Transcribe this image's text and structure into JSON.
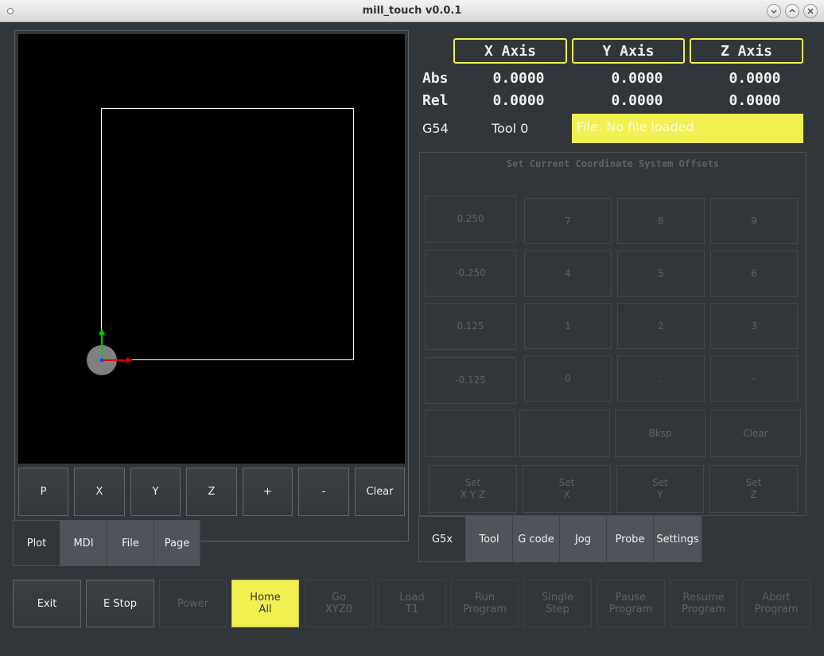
{
  "window": {
    "title": "mill_touch v0.0.1"
  },
  "plot_buttons": [
    "P",
    "X",
    "Y",
    "Z",
    "+",
    "-",
    "Clear"
  ],
  "left_tabs": [
    {
      "label": "Plot",
      "active": true
    },
    {
      "label": "MDI",
      "active": false
    },
    {
      "label": "File",
      "active": false
    },
    {
      "label": "Page",
      "active": false
    }
  ],
  "dro": {
    "axes": [
      "X Axis",
      "Y Axis",
      "Z Axis"
    ],
    "abs_label": "Abs",
    "rel_label": "Rel",
    "abs": [
      "0.0000",
      "0.0000",
      "0.0000"
    ],
    "rel": [
      "0.0000",
      "0.0000",
      "0.0000"
    ],
    "work_offset": "G54",
    "tool": "Tool 0",
    "file": "File: No file loaded"
  },
  "offsets": {
    "title": "Set Current Coordinate System Offsets",
    "increments": [
      "0.250",
      "-0.250",
      "0.125",
      "-0.125"
    ],
    "keys": [
      "7",
      "8",
      "9",
      "4",
      "5",
      "6",
      "1",
      "2",
      "3",
      "0",
      ".",
      "-"
    ],
    "bksp": "Bksp",
    "clear": "Clear",
    "set_buttons": [
      "Set\nX Y Z",
      "Set\nX",
      "Set\nY",
      "Set\nZ"
    ]
  },
  "right_tabs": [
    {
      "label": "G5x",
      "active": true
    },
    {
      "label": "Tool",
      "active": false
    },
    {
      "label": "G code",
      "active": false
    },
    {
      "label": "Jog",
      "active": false
    },
    {
      "label": "Probe",
      "active": false
    },
    {
      "label": "Settings",
      "active": false
    }
  ],
  "bottom_buttons": [
    {
      "label": "Exit",
      "state": "enabled"
    },
    {
      "label": "E Stop",
      "state": "enabled"
    },
    {
      "label": "Power",
      "state": "disabled"
    },
    {
      "label": "Home\nAll",
      "state": "highlight"
    },
    {
      "label": "Go\nXYZ0",
      "state": "disabled"
    },
    {
      "label": "Load\nT1",
      "state": "disabled"
    },
    {
      "label": "Run\nProgram",
      "state": "disabled"
    },
    {
      "label": "Single\nStep",
      "state": "disabled"
    },
    {
      "label": "Pause\nProgram",
      "state": "disabled"
    },
    {
      "label": "Resume\nProgram",
      "state": "disabled"
    },
    {
      "label": "Abort\nProgram",
      "state": "disabled"
    }
  ],
  "colors": {
    "accent": "#f0f050",
    "background": "#31363b",
    "text": "#eff0f1",
    "disabled_text": "#5c6165"
  }
}
